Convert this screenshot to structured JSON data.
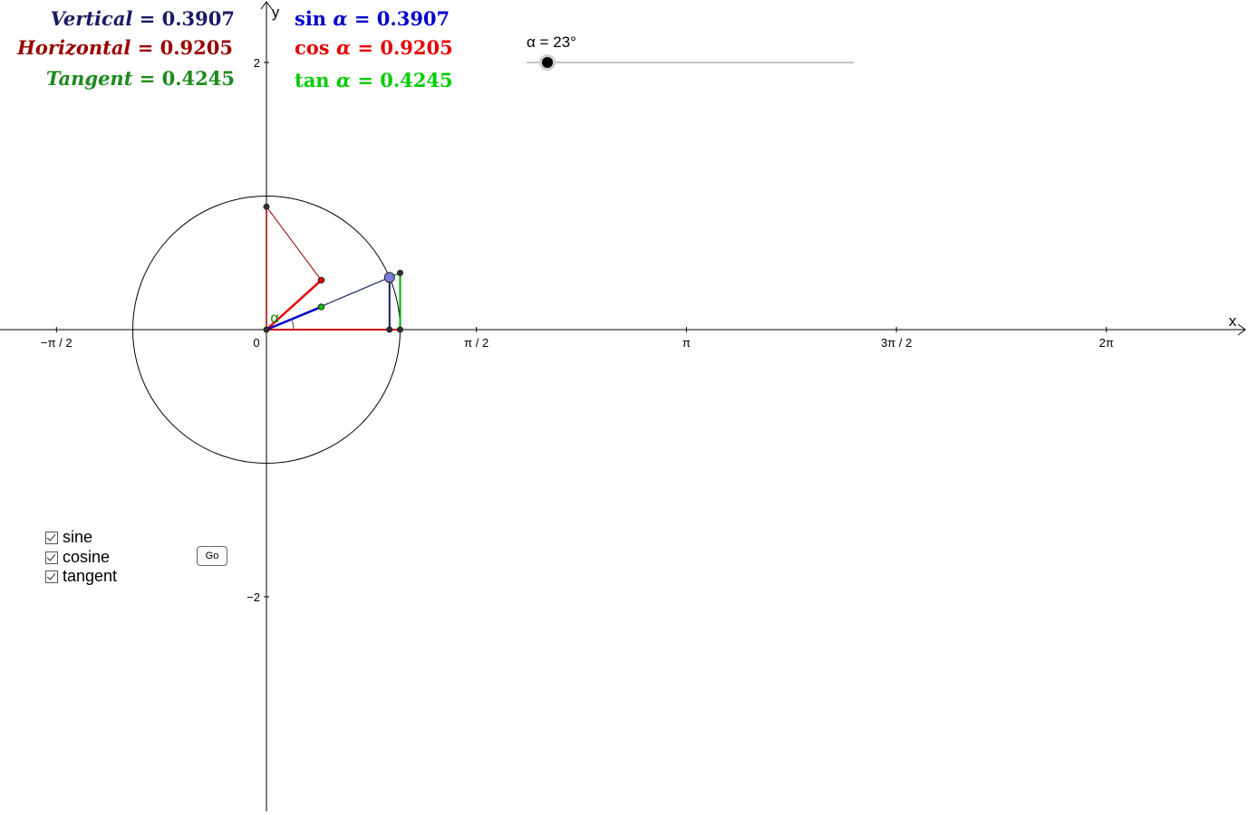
{
  "angle_deg": 23,
  "slider": {
    "label": "α = 23°",
    "min": 0,
    "max": 360,
    "value": 23
  },
  "readouts": {
    "vertical": {
      "name": "Vertical",
      "eq": " = ",
      "value": "0.3907",
      "color": "#1a1a66"
    },
    "horizontal": {
      "name": "Horizontal",
      "eq": " = ",
      "value": "0.9205",
      "color": "#990000"
    },
    "tangent": {
      "name": "Tangent",
      "eq": " = ",
      "value": "0.4245",
      "color": "#1c8a1c"
    },
    "sin": {
      "fn": "sin",
      "var": "α",
      "eq": " = ",
      "value": "0.3907",
      "color": "#0000cc"
    },
    "cos": {
      "fn": "cos",
      "var": "α",
      "eq": " = ",
      "value": "0.9205",
      "color": "#e60000"
    },
    "tan": {
      "fn": "tan",
      "var": "α",
      "eq": " = ",
      "value": "0.4245",
      "color": "#00cc00"
    }
  },
  "axes": {
    "x_label": "x",
    "y_label": "y",
    "x_ticks": [
      "−π / 2",
      "0",
      "π / 2",
      "π",
      "3π / 2",
      "2π"
    ],
    "y_ticks": [
      "2",
      "−2"
    ],
    "angle_label": "α"
  },
  "checkboxes": [
    {
      "label": "sine",
      "checked": true
    },
    {
      "label": "cosine",
      "checked": true
    },
    {
      "label": "tangent",
      "checked": true
    }
  ],
  "go_button": "Go",
  "colors": {
    "sine": "#1a1a66",
    "cosine": "#cc0000",
    "tangent": "#008800",
    "point": "#7b7bdd",
    "circle": "#000000"
  }
}
